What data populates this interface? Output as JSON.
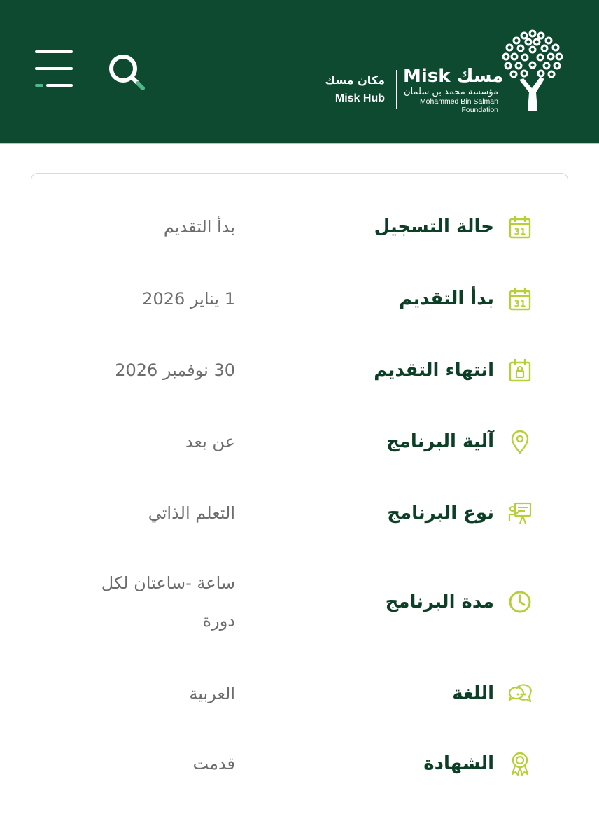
{
  "header": {
    "hub_ar": "مكان مسك",
    "hub_en": "Misk Hub",
    "brand_name": "Misk مسك",
    "foundation_ar": "مؤسسة محمد بن سلمان",
    "foundation_en_line1": "Mohammed Bin Salman",
    "foundation_en_line2": "Foundation",
    "menu_icon": "hamburger-menu-icon",
    "search_icon": "search-icon",
    "logo_icon": "misk-tree-logo-icon"
  },
  "colors": {
    "header_bg": "#0d4a30",
    "label_text": "#0d3f27",
    "value_text": "#6d6d6d",
    "icon_accent": "#b8cf3a"
  },
  "details": [
    {
      "label": "حالة التسجيل",
      "value": "بدأ التقديم",
      "icon": "calendar-icon"
    },
    {
      "label": "بدأ التقديم",
      "value": "1 يناير 2026",
      "icon": "calendar-icon"
    },
    {
      "label": "انتهاء التقديم",
      "value": "30 نوفمبر 2026",
      "icon": "calendar-lock-icon"
    },
    {
      "label": "آلية البرنامج",
      "value": "عن بعد",
      "icon": "location-pin-icon"
    },
    {
      "label": "نوع البرنامج",
      "value": "التعلم الذاتي",
      "icon": "presentation-board-icon"
    },
    {
      "label": "مدة البرنامج",
      "value": "ساعة -ساعتان لكل دورة",
      "icon": "clock-icon"
    },
    {
      "label": "اللغة",
      "value": "العربية",
      "icon": "chat-bubbles-icon"
    },
    {
      "label": "الشهادة",
      "value": "قدمت",
      "icon": "award-badge-icon"
    }
  ]
}
